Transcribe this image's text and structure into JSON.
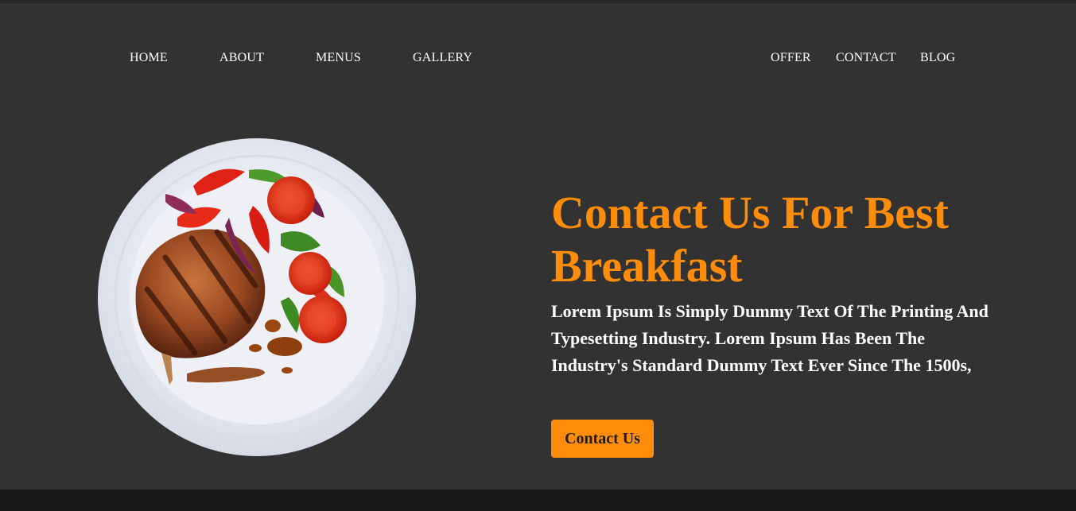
{
  "nav": {
    "left": [
      "HOME",
      "ABOUT",
      "MENUS",
      "GALLERY"
    ],
    "right": [
      "OFFER",
      "CONTACT",
      "BLOG"
    ]
  },
  "hero": {
    "headline_line1": "Contact Us For Best",
    "headline_line2": "Breakfast",
    "description": "Lorem Ipsum Is Simply Dummy Text Of The Printing And Typesetting Industry. Lorem Ipsum Has Been The Industry's Standard Dummy Text Ever Since The 1500s,",
    "cta_label": "Contact Us",
    "image_name": "plate-steak-salad-image"
  },
  "colors": {
    "background": "#323232",
    "accent": "#ff8c0a",
    "text": "#ffffff",
    "footer": "#181818"
  }
}
